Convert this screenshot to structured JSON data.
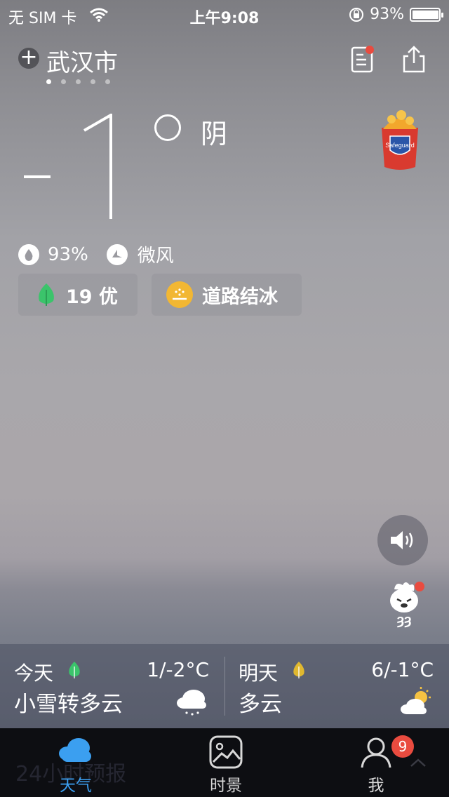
{
  "status_bar": {
    "carrier": "无 SIM 卡",
    "time": "上午9:08",
    "battery_percent": "93%",
    "battery_level": 0.93
  },
  "header": {
    "add_icon": "plus-icon",
    "city": "武汉市",
    "page_count": 5,
    "active_page": 1,
    "news_icon": "news-icon",
    "share_icon": "share-icon"
  },
  "current": {
    "temperature": "-1",
    "degree_symbol": "○",
    "condition": "阴",
    "humidity": "93%",
    "wind": "微风",
    "aqi": "19 优",
    "alert": "道路结冰",
    "colors": {
      "aqi_leaf": "#3bc46b",
      "alert_icon": "#f2b733"
    }
  },
  "ad": {
    "brand": "Safeguard"
  },
  "forecast": [
    {
      "day": "今天",
      "temp": "1/-2°C",
      "desc": "小雪转多云",
      "leaf_color": "#3bc46b",
      "icon": "snow-cloud-icon"
    },
    {
      "day": "明天",
      "temp": "6/-1°C",
      "desc": "多云",
      "leaf_color": "#e0b82f",
      "icon": "partly-cloudy-icon"
    }
  ],
  "tabbar": {
    "ghost_text": "24小时预报",
    "tabs": [
      {
        "label": "天气",
        "icon": "cloud-icon",
        "active": true
      },
      {
        "label": "时景",
        "icon": "photo-icon",
        "active": false
      },
      {
        "label": "我",
        "icon": "person-icon",
        "active": false
      }
    ],
    "me_badge": "9",
    "colors": {
      "active": "#3b9ff0",
      "inactive": "#d8d8d8"
    }
  }
}
